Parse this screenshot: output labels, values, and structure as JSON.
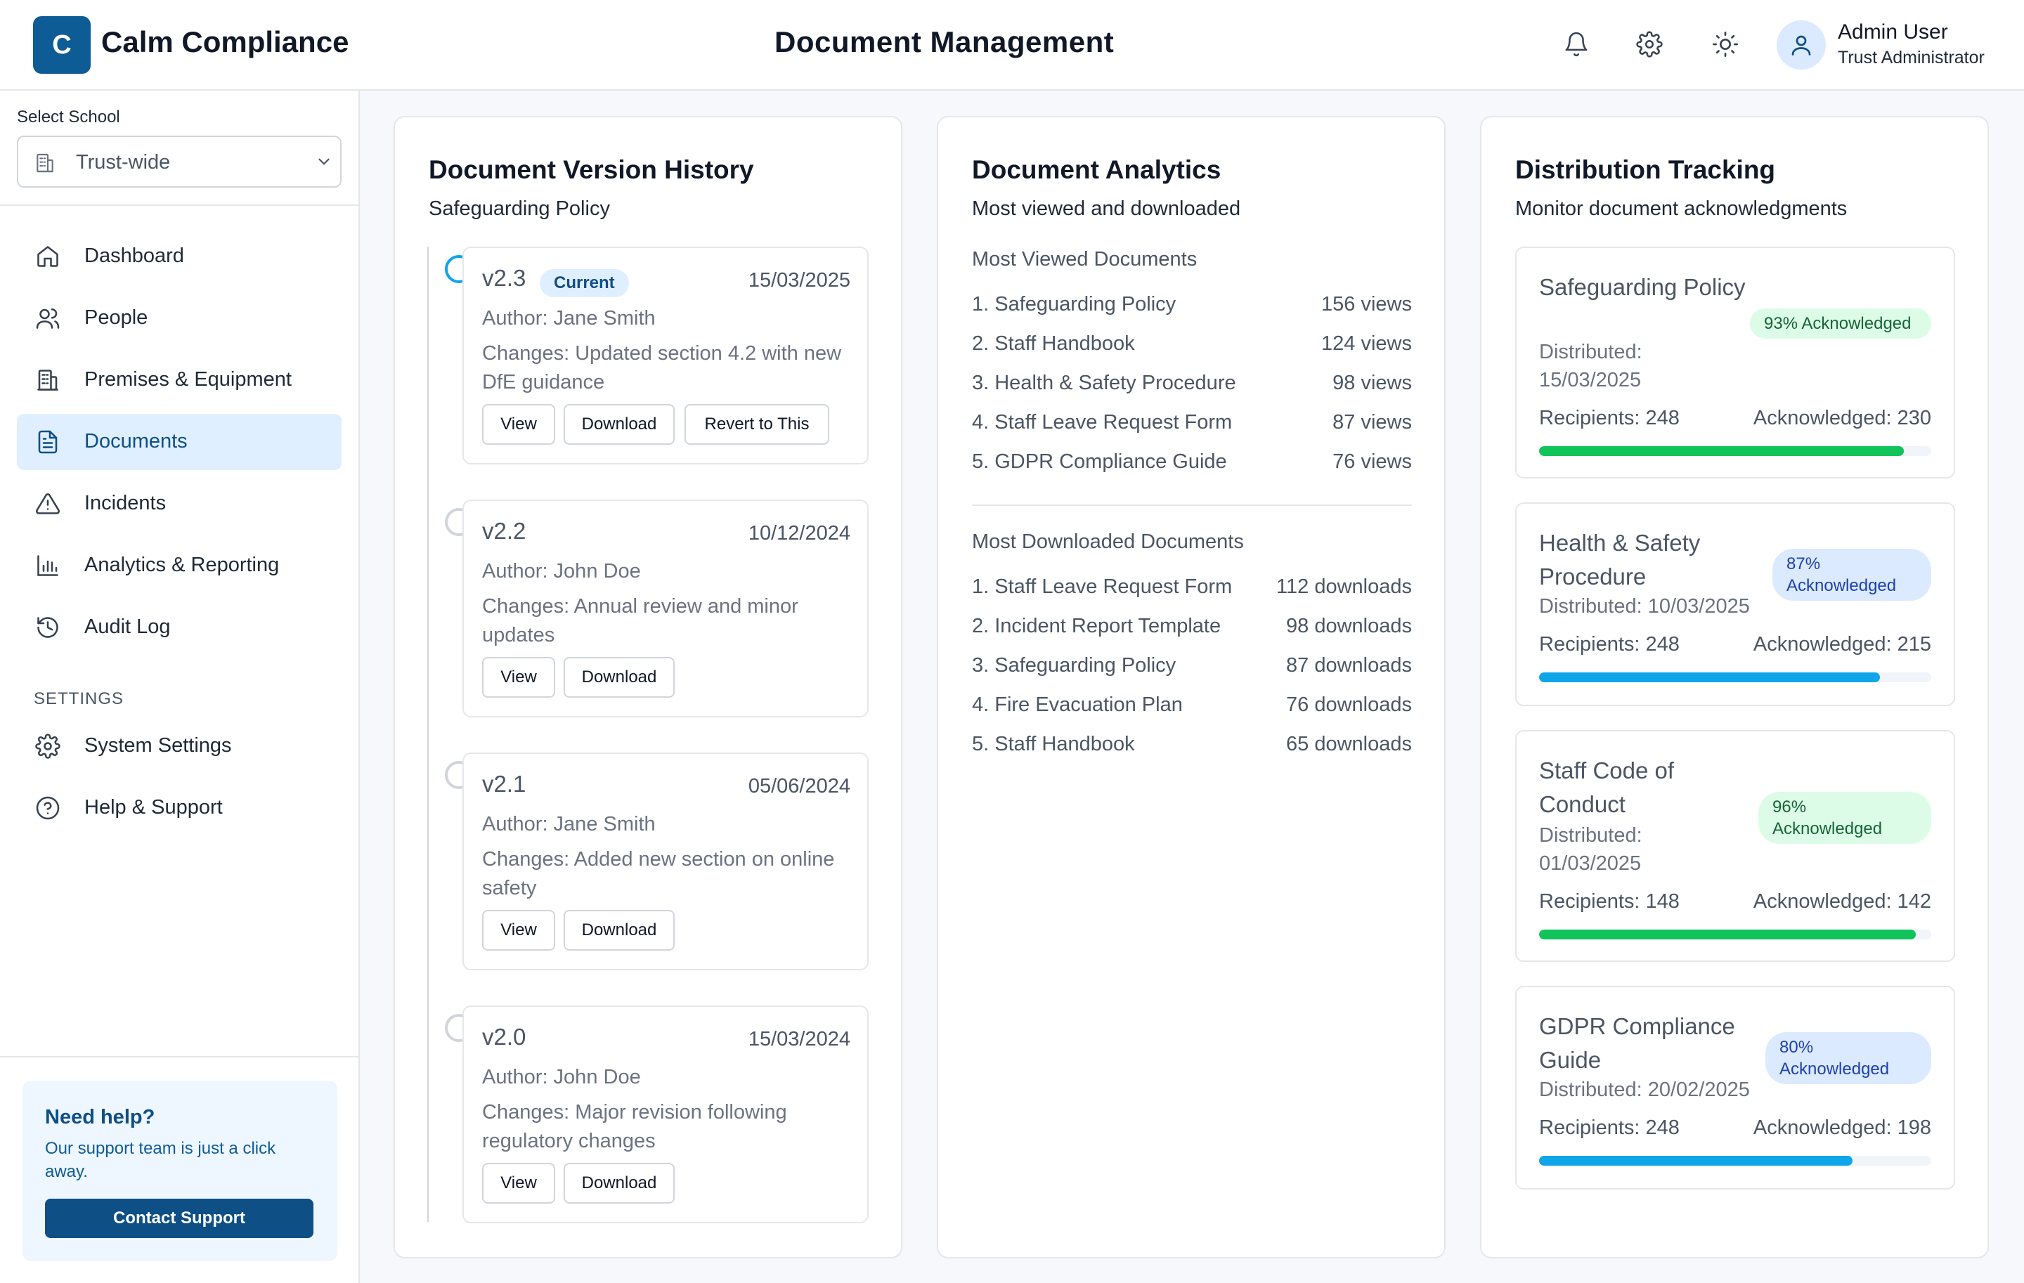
{
  "app": {
    "logo_letter": "C",
    "brand": "Calm Compliance",
    "page_title": "Document Management"
  },
  "header": {
    "icons": [
      "bell-icon",
      "gear-icon",
      "sun-icon",
      "user-icon"
    ],
    "user_name": "Admin User",
    "user_role": "Trust Administrator"
  },
  "sidebar": {
    "select_label": "Select School",
    "school_value": "Trust-wide",
    "nav": [
      {
        "label": "Dashboard",
        "icon": "home-icon"
      },
      {
        "label": "People",
        "icon": "people-icon"
      },
      {
        "label": "Premises & Equipment",
        "icon": "building-icon"
      },
      {
        "label": "Documents",
        "icon": "document-icon",
        "active": true
      },
      {
        "label": "Incidents",
        "icon": "warning-icon"
      },
      {
        "label": "Analytics & Reporting",
        "icon": "bar-chart-icon"
      },
      {
        "label": "Audit Log",
        "icon": "history-icon"
      }
    ],
    "settings_heading": "SETTINGS",
    "settings_nav": [
      {
        "label": "System Settings",
        "icon": "gear-icon"
      },
      {
        "label": "Help & Support",
        "icon": "help-icon"
      }
    ],
    "help": {
      "title": "Need help?",
      "text": "Our support team is just a click away.",
      "button": "Contact Support"
    }
  },
  "version_history": {
    "title": "Document Version History",
    "subtitle": "Safeguarding Policy",
    "versions": [
      {
        "version": "v2.3",
        "badge": "Current",
        "date": "15/03/2025",
        "author": "Author: Jane Smith",
        "changes": "Changes: Updated section 4.2 with new DfE guidance",
        "buttons": [
          "View",
          "Download",
          "Revert to This"
        ]
      },
      {
        "version": "v2.2",
        "date": "10/12/2024",
        "author": "Author: John Doe",
        "changes": "Changes: Annual review and minor updates",
        "buttons": [
          "View",
          "Download"
        ]
      },
      {
        "version": "v2.1",
        "date": "05/06/2024",
        "author": "Author: Jane Smith",
        "changes": "Changes: Added new section on online safety",
        "buttons": [
          "View",
          "Download"
        ]
      },
      {
        "version": "v2.0",
        "date": "15/03/2024",
        "author": "Author: John Doe",
        "changes": "Changes: Major revision following regulatory changes",
        "buttons": [
          "View",
          "Download"
        ]
      }
    ]
  },
  "analytics": {
    "title": "Document Analytics",
    "subtitle": "Most viewed and downloaded",
    "viewed_heading": "Most Viewed Documents",
    "viewed": [
      {
        "name": "1.  Safeguarding Policy",
        "count": "156 views"
      },
      {
        "name": "2.  Staff Handbook",
        "count": "124 views"
      },
      {
        "name": "3.  Health & Safety Procedure",
        "count": "98 views"
      },
      {
        "name": "4.  Staff Leave Request Form",
        "count": "87 views"
      },
      {
        "name": "5.  GDPR Compliance Guide",
        "count": "76 views"
      }
    ],
    "downloaded_heading": "Most Downloaded Documents",
    "downloaded": [
      {
        "name": "1.  Staff Leave Request Form",
        "count": "112 downloads"
      },
      {
        "name": "2.  Incident Report Template",
        "count": "98 downloads"
      },
      {
        "name": "3.  Safeguarding Policy",
        "count": "87 downloads"
      },
      {
        "name": "4.  Fire Evacuation Plan",
        "count": "76 downloads"
      },
      {
        "name": "5.  Staff Handbook",
        "count": "65 downloads"
      }
    ]
  },
  "distribution": {
    "title": "Distribution Tracking",
    "subtitle": "Monitor document acknowledgments",
    "items": [
      {
        "title": "Safeguarding Policy",
        "distributed": "Distributed: 15/03/2025",
        "pill": "93% Acknowledged",
        "recipients": "Recipients: 248",
        "acknowledged": "Acknowledged: 230",
        "fraction": 0.93,
        "color": "#10c45a"
      },
      {
        "title": "Health & Safety Procedure",
        "distributed": "Distributed: 10/03/2025",
        "pill": "87% Acknowledged",
        "recipients": "Recipients: 248",
        "acknowledged": "Acknowledged: 215",
        "fraction": 0.87,
        "color": "#0ea5e9"
      },
      {
        "title": "Staff Code of Conduct",
        "distributed": "Distributed: 01/03/2025",
        "pill": "96% Acknowledged",
        "recipients": "Recipients: 148",
        "acknowledged": "Acknowledged: 142",
        "fraction": 0.96,
        "color": "#10c45a"
      },
      {
        "title": "GDPR Compliance Guide",
        "distributed": "Distributed: 20/02/2025",
        "pill": "80% Acknowledged",
        "recipients": "Recipients: 248",
        "acknowledged": "Acknowledged: 198",
        "fraction": 0.8,
        "color": "#0ea5e9"
      }
    ]
  }
}
